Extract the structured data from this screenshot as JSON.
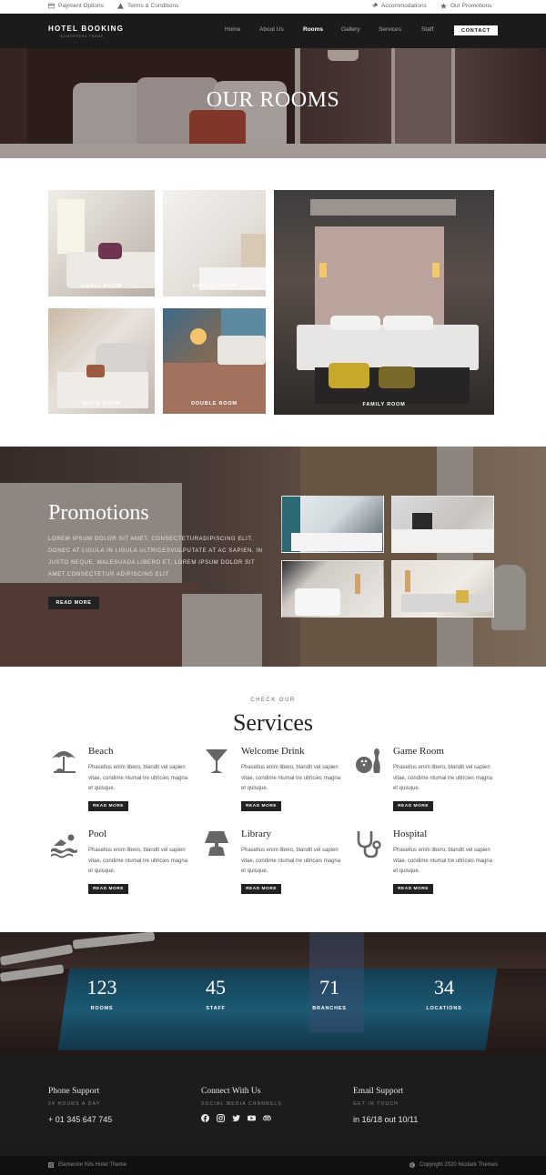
{
  "topbar": {
    "left": [
      {
        "label": "Payment Options",
        "icon": "credit-card-icon"
      },
      {
        "label": "Terms & Conditions",
        "icon": "warning-icon"
      }
    ],
    "right": [
      {
        "label": "Accommodations",
        "icon": "key-icon"
      },
      {
        "label": "Our Promotions",
        "icon": "star-icon"
      }
    ]
  },
  "nav": {
    "brand": "HOTEL BOOKING",
    "brand_sub": "WORDPRESS THEME",
    "links": [
      "Home",
      "About Us",
      "Rooms",
      "Gallery",
      "Services",
      "Staff"
    ],
    "active": "Rooms",
    "contact": "CONTACT"
  },
  "hero": {
    "title": "OUR ROOMS"
  },
  "rooms": [
    {
      "caption": "SMALL ROOM"
    },
    {
      "caption": "SINGLE ROOM"
    },
    {
      "caption": "SUITE ROOM"
    },
    {
      "caption": "DOUBLE ROOM"
    },
    {
      "caption": "FAMILY ROOM"
    }
  ],
  "promotions": {
    "title": "Promotions",
    "text": "LOREM IPSUM DOLOR SIT AMET, CONSECTETURADIPISCING ELIT. DONEC AT LIGULA IN LIGULA ULTRICESVULPUTATE AT AC SAPIEN. IN JUSTO NEQUE, MALESUADA LIBERO ET, LOREM IPSUM DOLOR SIT AMET,CONSECTETUR ADIPISCING ELIT",
    "button": "READ MORE"
  },
  "services": {
    "kicker": "CHECK OUR",
    "title": "Services",
    "items": [
      {
        "name": "Beach",
        "icon": "beach-umbrella-icon",
        "desc": "Phasellus enim libero, blandit vel sapien vitae, condime ntumal tre ultricies magna et quisque.",
        "button": "READ MORE"
      },
      {
        "name": "Welcome Drink",
        "icon": "cocktail-icon",
        "desc": "Phasellus enim libero, blandit vel sapien vitae, condime ntumal tre ultricies magna et quisque.",
        "button": "READ MORE"
      },
      {
        "name": "Game Room",
        "icon": "bowling-icon",
        "desc": "Phasellus enim libero, blandit vel sapien vitae, condime ntumal tre ultricies magna et quisque.",
        "button": "READ MORE"
      },
      {
        "name": "Pool",
        "icon": "swimmer-icon",
        "desc": "Phasellus enim libero, blandit vel sapien vitae, condime ntumal tre ultricies magna et quisque.",
        "button": "READ MORE"
      },
      {
        "name": "Library",
        "icon": "desk-lamp-icon",
        "desc": "Phasellus enim libero, blandit vel sapien vitae, condime ntumal tre ultricies magna et quisque.",
        "button": "READ MORE"
      },
      {
        "name": "Hospital",
        "icon": "stethoscope-icon",
        "desc": "Phasellus enim libero, blandit vel sapien vitae, condime ntumal tre ultricies magna et quisque.",
        "button": "READ MORE"
      }
    ]
  },
  "stats": [
    {
      "value": "123",
      "label": "ROOMS"
    },
    {
      "value": "45",
      "label": "STAFF"
    },
    {
      "value": "71",
      "label": "BRANCHES"
    },
    {
      "value": "34",
      "label": "LOCATIONS"
    }
  ],
  "footer": {
    "phone": {
      "heading": "Phone Support",
      "sub": "24 HOURS A DAY",
      "value": "+ 01 345 647 745"
    },
    "connect": {
      "heading": "Connect With Us",
      "sub": "SOCIAL MEDIA CHANNELS",
      "icons": [
        "facebook-icon",
        "instagram-icon",
        "twitter-icon",
        "youtube-icon",
        "tripadvisor-icon"
      ]
    },
    "email": {
      "heading": "Email Support",
      "sub": "GET IN TOUCH",
      "value": "in 16/18 out 10/11"
    }
  },
  "bottombar": {
    "left": "Elementor Kits Hotel Theme",
    "right": "Copyright 2020 Nicdark Themes"
  },
  "colors": {
    "dark": "#1b1b1b",
    "footer": "#1c1c1c",
    "button": "#222222",
    "icon": "#666666"
  }
}
